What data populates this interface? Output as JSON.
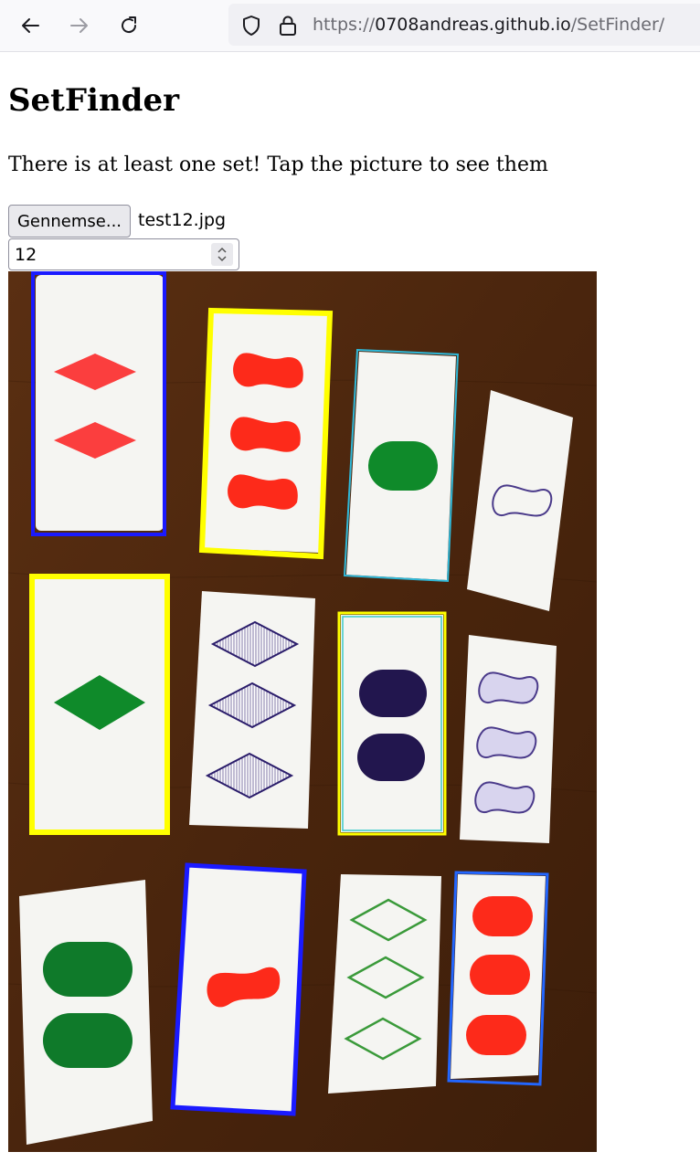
{
  "browser": {
    "url_scheme": "https://",
    "url_host": "0708andreas.github.io",
    "url_path": "/SetFinder/"
  },
  "page": {
    "title": "SetFinder",
    "message": "There is at least one set! Tap the picture to see them",
    "file_button_label": "Gennemse...",
    "file_name": "test12.jpg",
    "number_input_value": "12"
  },
  "photo": {
    "description_icon": "set-cards-photo",
    "cards": [
      {
        "row": 1,
        "col": 1,
        "count": 2,
        "shape": "diamond",
        "color": "red",
        "shading": "solid",
        "highlight": "#1a1aff"
      },
      {
        "row": 1,
        "col": 2,
        "count": 3,
        "shape": "squiggle",
        "color": "red",
        "shading": "solid",
        "highlight": "#ffff00"
      },
      {
        "row": 1,
        "col": 3,
        "count": 1,
        "shape": "oval",
        "color": "green",
        "shading": "solid",
        "highlight": "#2fb8d8"
      },
      {
        "row": 1,
        "col": 4,
        "count": 1,
        "shape": "squiggle",
        "color": "purple",
        "shading": "open",
        "highlight": ""
      },
      {
        "row": 2,
        "col": 1,
        "count": 1,
        "shape": "diamond",
        "color": "green",
        "shading": "solid",
        "highlight": "#ffff00"
      },
      {
        "row": 2,
        "col": 2,
        "count": 3,
        "shape": "diamond",
        "color": "purple",
        "shading": "striped",
        "highlight": ""
      },
      {
        "row": 2,
        "col": 3,
        "count": 2,
        "shape": "oval",
        "color": "purple",
        "shading": "solid",
        "highlight": "#ffff00"
      },
      {
        "row": 2,
        "col": 4,
        "count": 3,
        "shape": "squiggle",
        "color": "purple",
        "shading": "striped",
        "highlight": ""
      },
      {
        "row": 3,
        "col": 1,
        "count": 2,
        "shape": "oval",
        "color": "green",
        "shading": "solid",
        "highlight": ""
      },
      {
        "row": 3,
        "col": 2,
        "count": 1,
        "shape": "squiggle",
        "color": "red",
        "shading": "solid",
        "highlight": "#1a1aff"
      },
      {
        "row": 3,
        "col": 3,
        "count": 3,
        "shape": "diamond",
        "color": "green",
        "shading": "open",
        "highlight": ""
      },
      {
        "row": 3,
        "col": 4,
        "count": 3,
        "shape": "oval",
        "color": "red",
        "shading": "solid",
        "highlight": "#1a1aff"
      }
    ]
  }
}
